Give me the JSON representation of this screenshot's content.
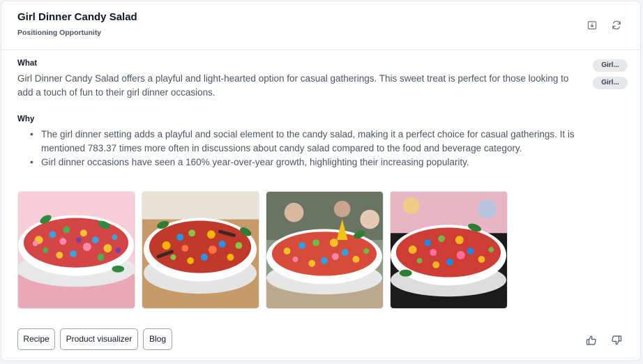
{
  "card": {
    "title": "Girl Dinner Candy Salad",
    "subtitle": "Positioning Opportunity",
    "header_icons": [
      "export-icon",
      "refresh-icon"
    ]
  },
  "what": {
    "label": "What",
    "text": "Girl Dinner Candy Salad offers a playful and light-hearted option for casual gatherings. This sweet treat is perfect for those looking to add a touch of fun to their girl dinner occasions."
  },
  "why": {
    "label": "Why",
    "bullets": [
      "The girl dinner setting adds a playful and social element to the candy salad, making it a perfect choice for casual gatherings. It is mentioned 783.37 times more often in discussions about candy salad compared to the food and beverage category.",
      "Girl dinner occasions have seen a 160% year-over-year growth, highlighting their increasing popularity."
    ]
  },
  "tags": [
    "Girl...",
    "Girl..."
  ],
  "images": [
    {
      "name": "candy-salad-pink-background"
    },
    {
      "name": "candy-salad-wooden-table"
    },
    {
      "name": "candy-salad-party-scene"
    },
    {
      "name": "candy-salad-dark-background"
    }
  ],
  "actions": {
    "recipe": "Recipe",
    "product_visualizer": "Product visualizer",
    "blog": "Blog"
  },
  "feedback_icons": [
    "thumbs-up-icon",
    "thumbs-down-icon"
  ],
  "colors": {
    "text_primary": "#111827",
    "text_body": "#4b5563",
    "border": "#e5e7eb",
    "tag_bg": "#e5e7eb"
  }
}
